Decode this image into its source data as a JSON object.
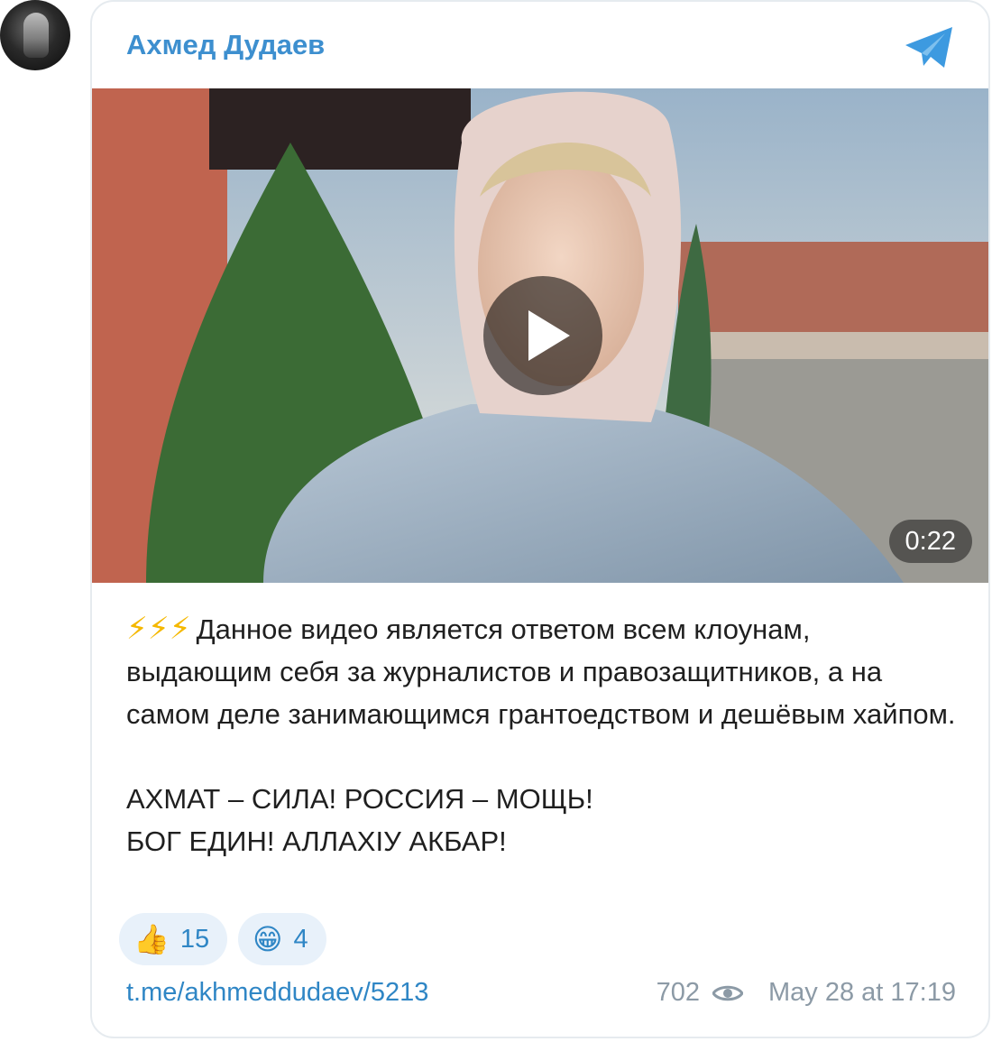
{
  "channel": {
    "name": "Ахмед Дудаев"
  },
  "video": {
    "duration": "0:22"
  },
  "post": {
    "bolts": "⚡⚡⚡",
    "text_main": "Данное видео является ответом всем клоунам, выдающим себя за журналистов и правозащитников, а на самом деле занимающимся грантоедством и дешёвым хайпом.",
    "line2": "АХМАТ – СИЛА! РОССИЯ – МОЩЬ!",
    "line3": "БОГ ЕДИН! АЛЛАХIУ АКБАР!"
  },
  "reactions": [
    {
      "emoji": "👍",
      "icon": "thumbs-up-icon",
      "count": "15"
    },
    {
      "emoji": "😁",
      "icon": "grinning-face-icon",
      "count": "4"
    }
  ],
  "footer": {
    "link": "t.me/akhmeddudaev/5213",
    "views": "702",
    "date": "May 28 at 17:19"
  },
  "colors": {
    "accent": "#3d8fcf",
    "link": "#2f86c5",
    "meta": "#8c9aa6",
    "reaction_bg": "#e8f1fa"
  }
}
